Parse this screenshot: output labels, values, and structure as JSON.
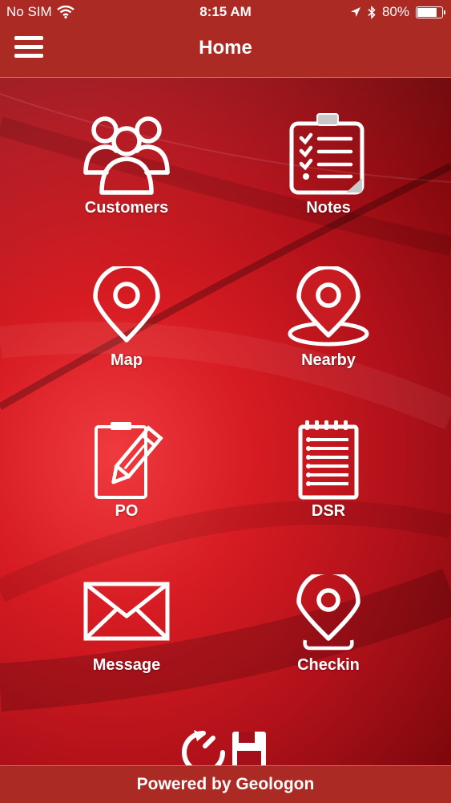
{
  "status_bar": {
    "carrier": "No SIM",
    "time": "8:15 AM",
    "battery_text": "80%",
    "battery_level": 0.8
  },
  "nav": {
    "title": "Home"
  },
  "tiles": [
    {
      "label": "Customers",
      "icon": "customers-icon"
    },
    {
      "label": "Notes",
      "icon": "notes-icon"
    },
    {
      "label": "Map",
      "icon": "map-pin-icon"
    },
    {
      "label": "Nearby",
      "icon": "nearby-icon"
    },
    {
      "label": "PO",
      "icon": "po-clipboard-icon"
    },
    {
      "label": "DSR",
      "icon": "dsr-notepad-icon"
    },
    {
      "label": "Message",
      "icon": "envelope-icon"
    },
    {
      "label": "Checkin",
      "icon": "checkin-icon"
    }
  ],
  "footer": {
    "text": "Powered by Geologon"
  },
  "colors": {
    "header": "#ab2a24",
    "accent": "#d61b22",
    "icon": "#ffffff"
  }
}
